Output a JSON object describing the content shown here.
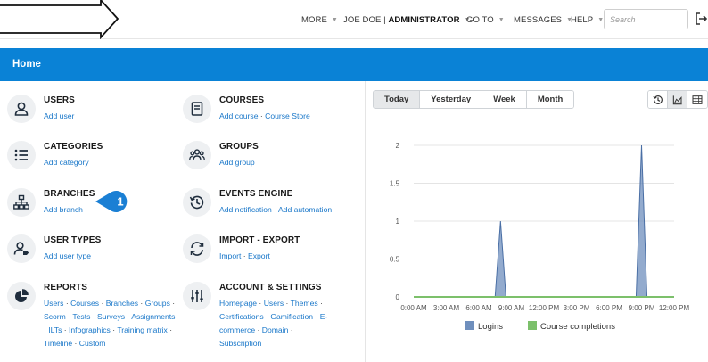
{
  "topbar": {
    "nav": [
      {
        "label": "MORE",
        "caret": true
      },
      {
        "label": "JOE DOE",
        "sep": " | ",
        "role": "ADMINISTRATOR",
        "caret": true
      },
      {
        "label": "GO TO",
        "caret": true
      },
      {
        "label": "MESSAGES",
        "caret": true
      },
      {
        "label": "HELP",
        "caret": true
      }
    ],
    "search_placeholder": "Search",
    "icons": {
      "menu": "outline-arrow-icon",
      "logout": "logout-icon"
    }
  },
  "header": {
    "title": "Home"
  },
  "tiles": [
    {
      "title": "USERS",
      "icon": "user-icon",
      "links": [
        "Add user"
      ]
    },
    {
      "title": "COURSES",
      "icon": "book-icon",
      "links": [
        "Add course",
        "Course Store"
      ]
    },
    {
      "title": "CATEGORIES",
      "icon": "list-icon",
      "links": [
        "Add category"
      ]
    },
    {
      "title": "GROUPS",
      "icon": "group-icon",
      "links": [
        "Add group"
      ]
    },
    {
      "title": "BRANCHES",
      "icon": "sitemap-icon",
      "links": [
        "Add branch"
      ]
    },
    {
      "title": "EVENTS ENGINE",
      "icon": "history-icon",
      "links": [
        "Add notification",
        "Add automation"
      ]
    },
    {
      "title": "USER TYPES",
      "icon": "user-tag-icon",
      "links": [
        "Add user type"
      ]
    },
    {
      "title": "IMPORT - EXPORT",
      "icon": "sync-icon",
      "links": [
        "Import",
        "Export"
      ]
    },
    {
      "title": "REPORTS",
      "icon": "pie-chart-icon",
      "links": [
        "Users",
        "Courses",
        "Branches",
        "Groups",
        "Scorm",
        "Tests",
        "Surveys",
        "Assignments",
        "ILTs",
        "Infographics",
        "Training matrix",
        "Timeline",
        "Custom"
      ]
    },
    {
      "title": "ACCOUNT & SETTINGS",
      "icon": "sliders-icon",
      "links": [
        "Homepage",
        "Users",
        "Themes",
        "Certifications",
        "Gamification",
        "E-commerce",
        "Domain",
        "Subscription"
      ]
    }
  ],
  "callout": {
    "number": "1",
    "color": "#1a7fd4"
  },
  "period_tabs": [
    {
      "label": "Today",
      "active": true
    },
    {
      "label": "Yesterday",
      "active": false
    },
    {
      "label": "Week",
      "active": false
    },
    {
      "label": "Month",
      "active": false
    }
  ],
  "view_icons": [
    {
      "icon": "history-icon",
      "active": false
    },
    {
      "icon": "area-chart-icon",
      "active": true
    },
    {
      "icon": "table-icon",
      "active": false
    }
  ],
  "colors": {
    "brand_blue": "#0a82d6",
    "link": "#1977c9",
    "logins": "#6f8fbd",
    "completions": "#7cc06b"
  },
  "chart_data": {
    "type": "area",
    "x": [
      "0:00 AM",
      "3:00 AM",
      "6:00 AM",
      "9:00 AM",
      "12:00 PM",
      "3:00 PM",
      "6:00 PM",
      "9:00 PM",
      "12:00 PM"
    ],
    "ylim": [
      0,
      2
    ],
    "yticks": [
      "0",
      "0.5",
      "1",
      "1.5",
      "2"
    ],
    "series": [
      {
        "name": "Logins",
        "color": "#6f8fbd",
        "points": [
          [
            0,
            0
          ],
          [
            6,
            0
          ],
          [
            7.5,
            0
          ],
          [
            8,
            1
          ],
          [
            8.5,
            0
          ],
          [
            9,
            0
          ],
          [
            20,
            0
          ],
          [
            20.5,
            0
          ],
          [
            21,
            2
          ],
          [
            21.5,
            0
          ],
          [
            22,
            0
          ],
          [
            24,
            0
          ]
        ]
      },
      {
        "name": "Course completions",
        "color": "#7cc06b",
        "points": [
          [
            0,
            0
          ],
          [
            24,
            0
          ]
        ]
      }
    ],
    "grid": true,
    "legend": "bottom"
  }
}
